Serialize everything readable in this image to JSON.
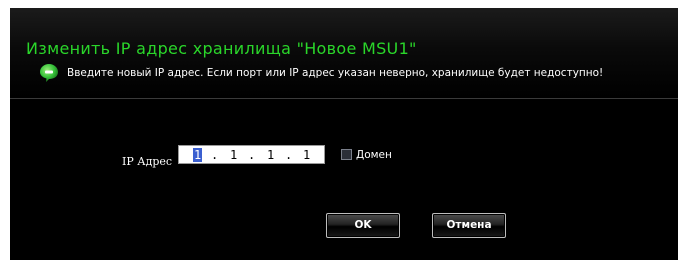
{
  "dialog": {
    "title": "Изменить IP адрес хранилища \"Новое MSU1\"",
    "hint": "Введите новый  IP адрес. Если порт или IP адрес указан неверно, хранилище будет недоступно!"
  },
  "form": {
    "ip_label": "IP Адрес",
    "ip_octets": [
      "1",
      "1",
      "1",
      "1"
    ],
    "ip_separator": ".",
    "domain_label": "Домен",
    "domain_checked": false
  },
  "buttons": {
    "ok": "OK",
    "cancel": "Отмена"
  },
  "colors": {
    "title": "#2ad62a",
    "background": "#000000",
    "icon": "#36c23a"
  },
  "icons": {
    "hint": "info-bubble-icon"
  }
}
